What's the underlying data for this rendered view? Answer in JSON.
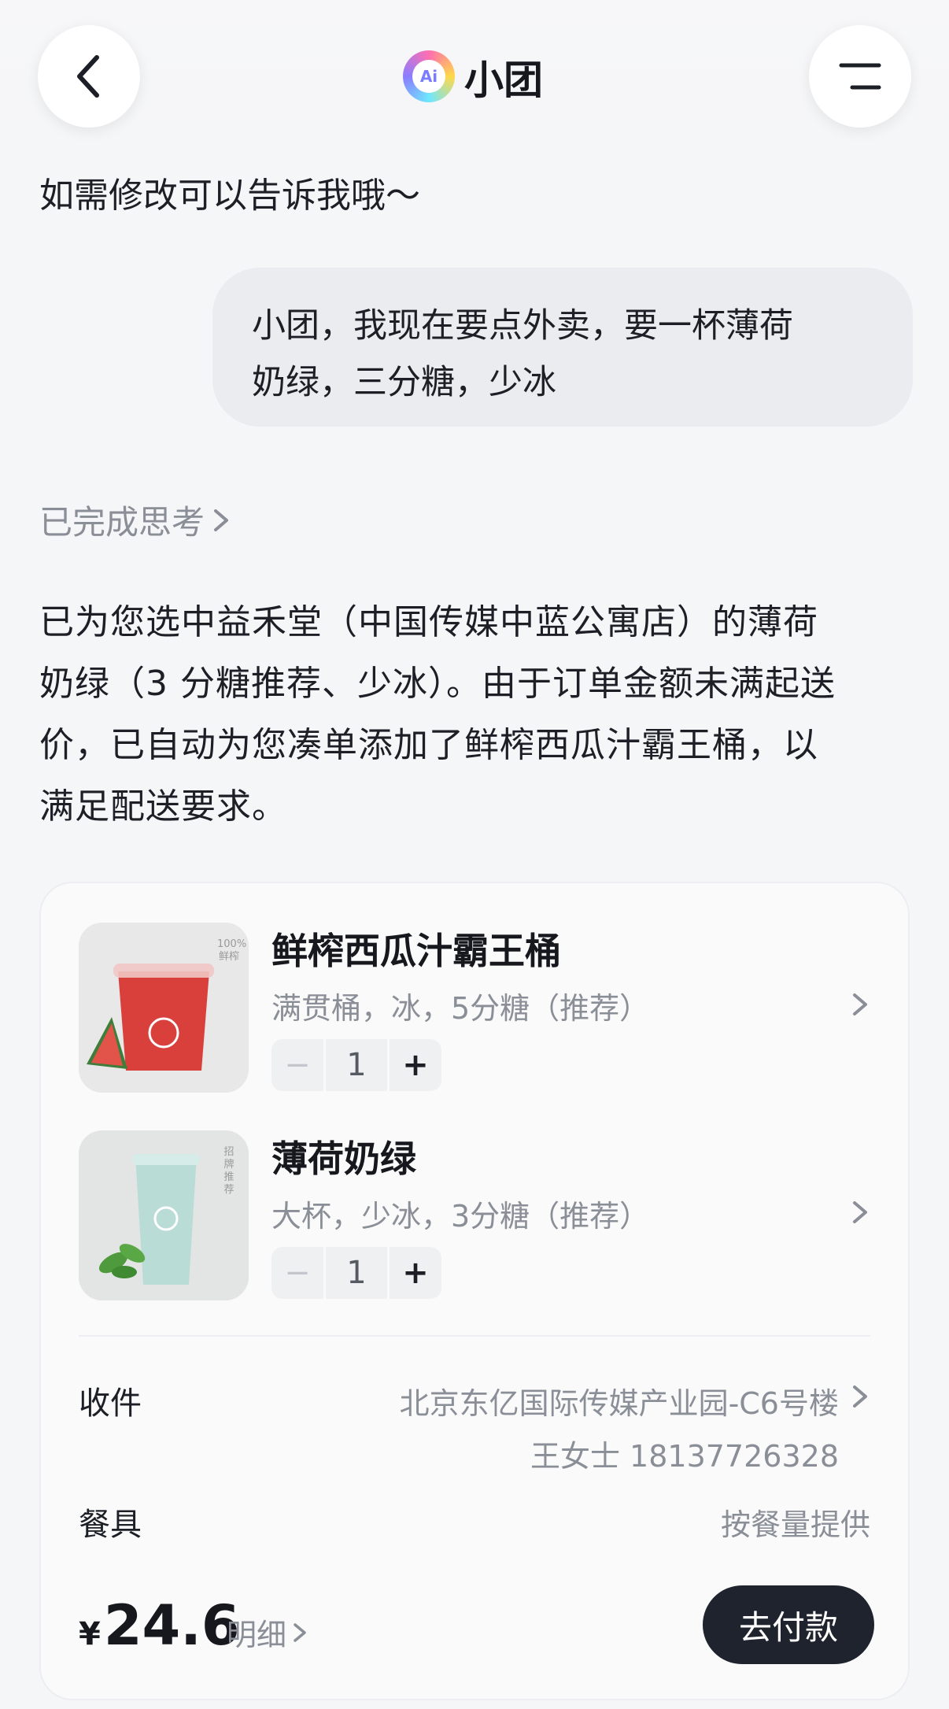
{
  "header": {
    "title": "小团",
    "logo_text": "Ai"
  },
  "chat": {
    "prev_message": "如需修改可以告诉我哦～",
    "user_message_line1": "小团，我现在要点外卖，要一杯薄荷",
    "user_message_line2": "奶绿，三分糖，少冰",
    "thinking_label": "已完成思考",
    "answer_lines": [
      "已为您选中益禾堂（中国传媒中蓝公寓店）的薄荷",
      "奶绿（3 分糖推荐、少冰）。由于订单金额未满起送",
      "价，已自动为您凑单添加了鲜榨西瓜汁霸王桶，以",
      "满足配送要求。"
    ]
  },
  "order": {
    "items": [
      {
        "name": "鲜榨西瓜汁霸王桶",
        "spec": "满贯桶，冰，5分糖（推荐）",
        "qty": "1",
        "badge": "100%鲜榨"
      },
      {
        "name": "薄荷奶绿",
        "spec": "大杯，少冰，3分糖（推荐）",
        "qty": "1",
        "badge": "招牌推荐"
      }
    ],
    "stepper": {
      "minus": "−",
      "plus": "+"
    },
    "receiver_label": "收件",
    "receiver_address": "北京东亿国际传媒产业园-C6号楼",
    "receiver_contact": "王女士 18137726328",
    "tableware_label": "餐具",
    "tableware_value": "按餐量提供",
    "currency": "¥",
    "total": "24.6",
    "detail_label": "明细",
    "pay_button": "去付款"
  },
  "colors": {
    "pay_button_bg": "#1f232e",
    "watermelon": "#d9403b",
    "mint": "#b9ddd6"
  }
}
